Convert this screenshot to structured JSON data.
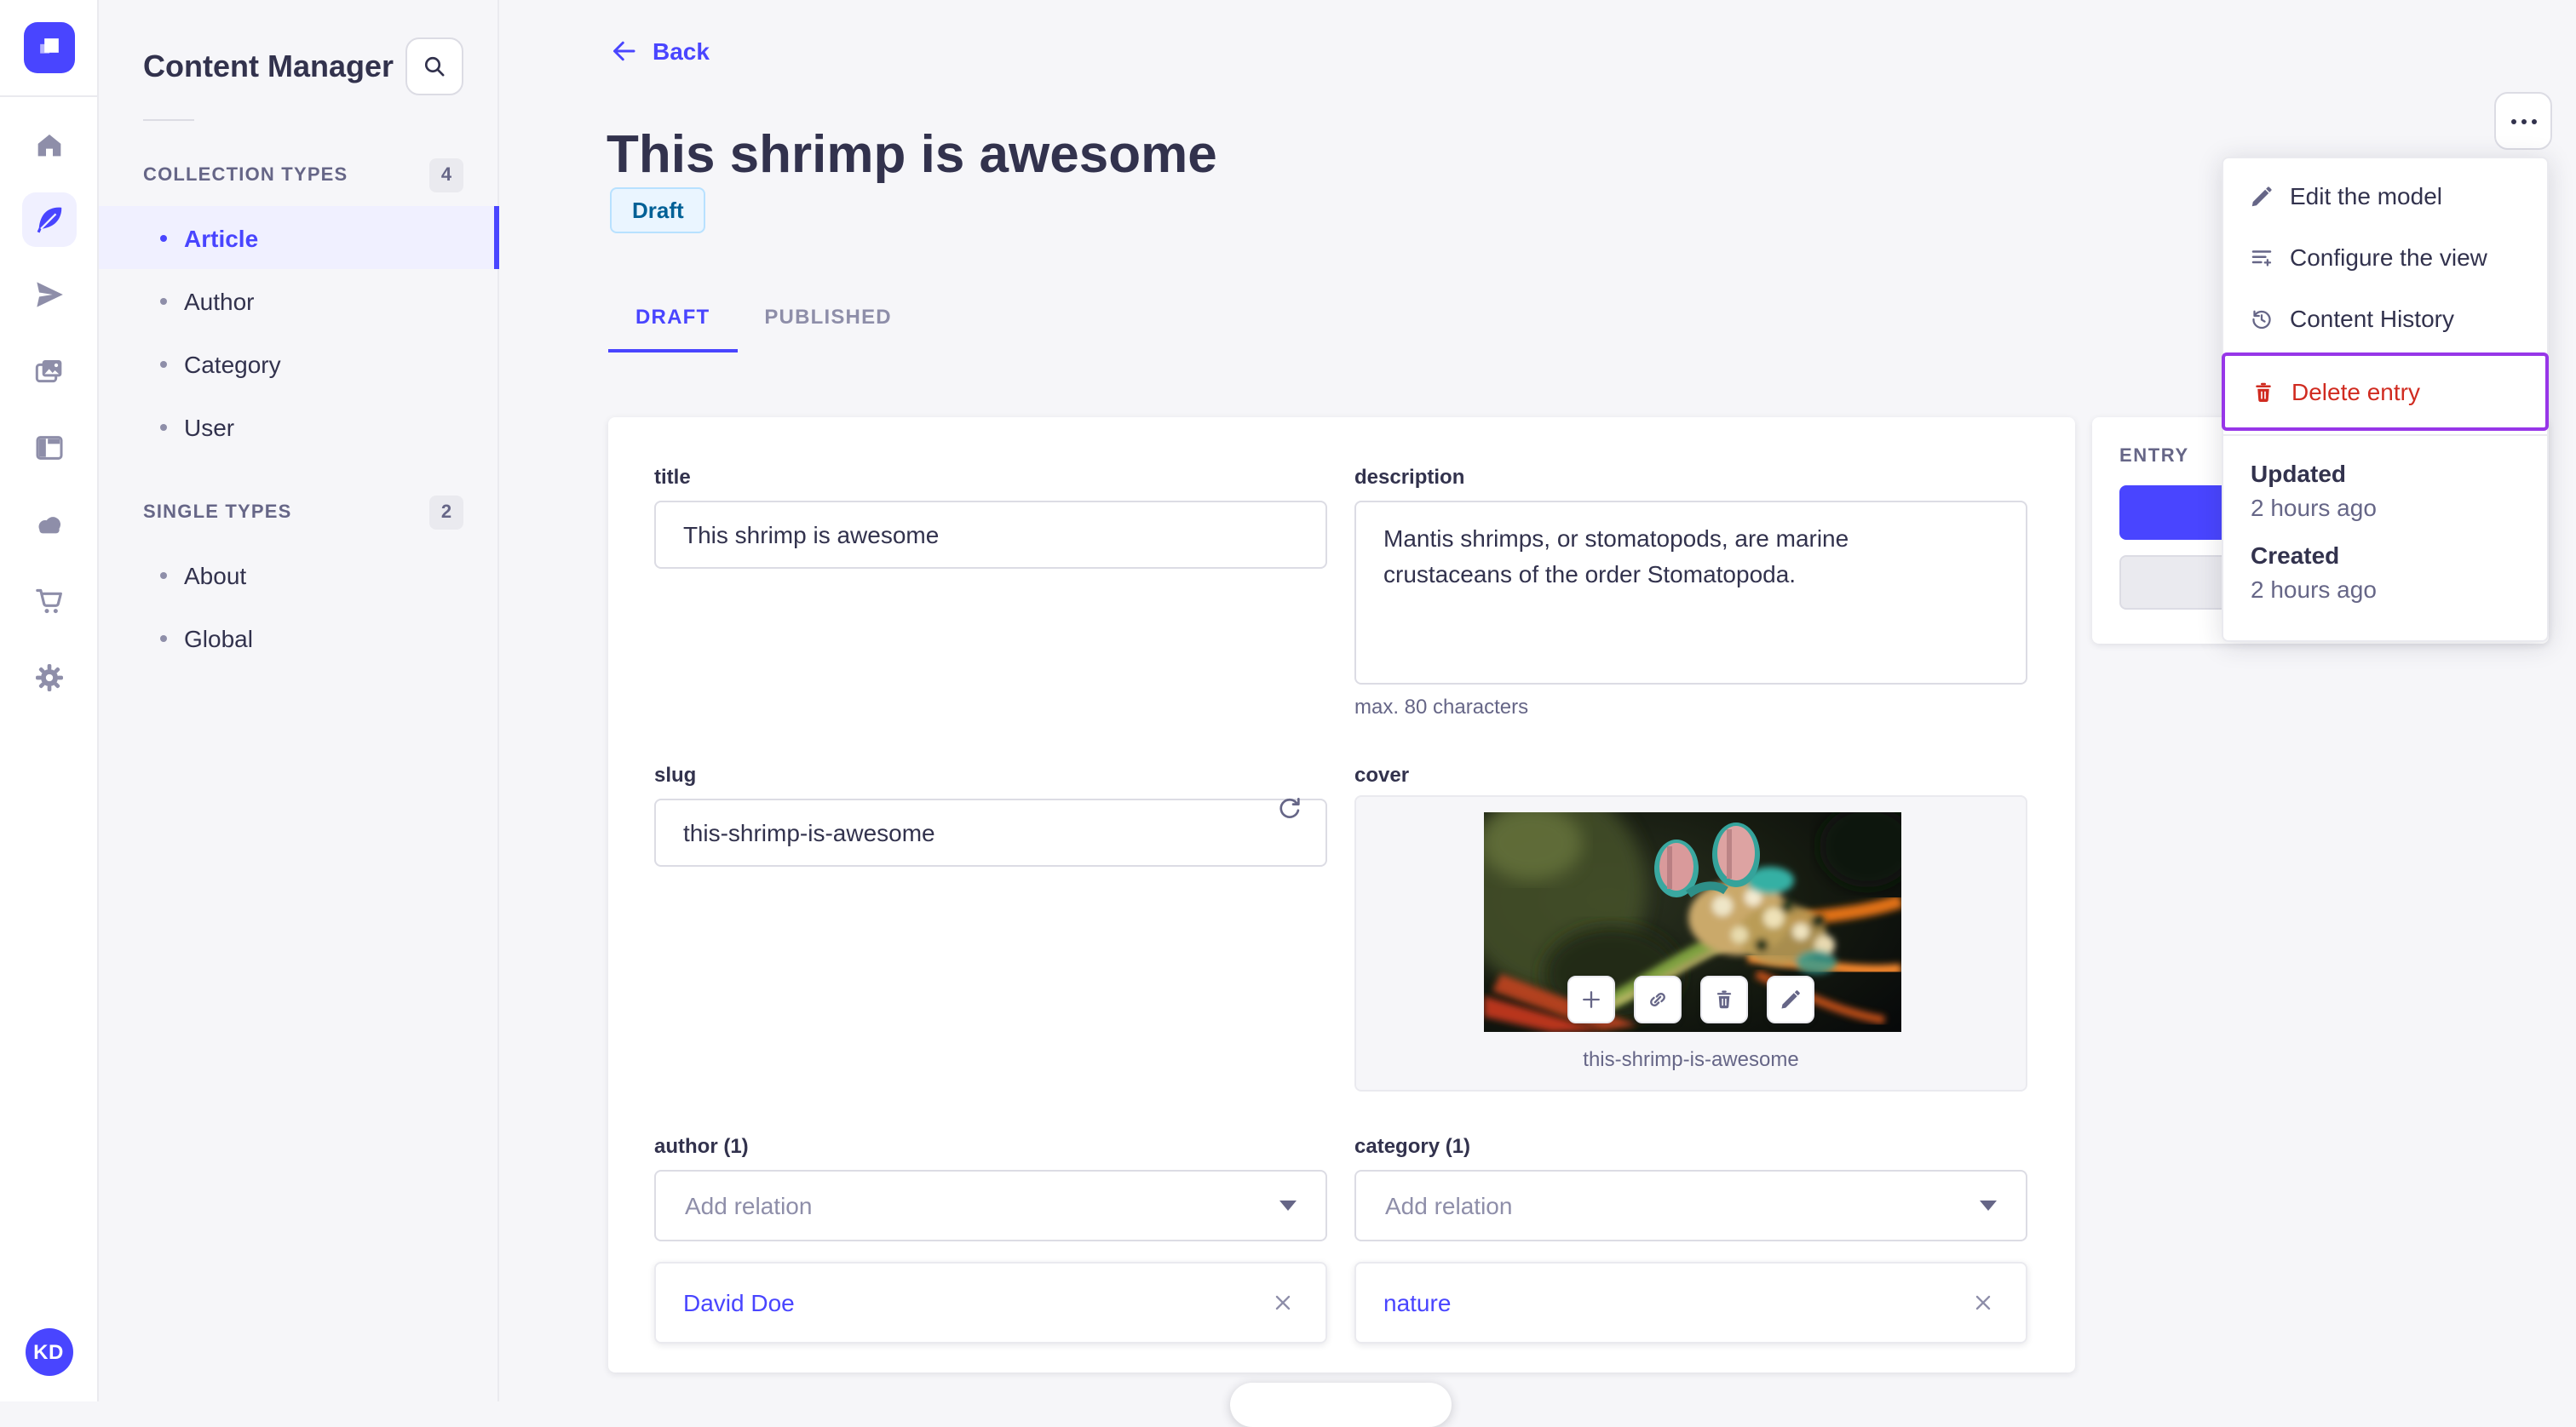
{
  "colors": {
    "primary": "#4945ff",
    "primary_light": "#f0f0ff",
    "danger": "#d02b20",
    "highlight_border": "#9736e8",
    "text": "#32324d",
    "text_muted": "#666687",
    "draft_bg": "#eaf5ff",
    "draft_border": "#b8e1ff",
    "draft_text": "#006096",
    "background": "#f6f6f9"
  },
  "iconbar": {
    "logo_icon": "strapi-logo",
    "items": [
      {
        "icon": "home-icon",
        "active": false
      },
      {
        "icon": "feather-icon",
        "active": true
      },
      {
        "icon": "paper-plane-icon",
        "active": false
      },
      {
        "icon": "media-images-icon",
        "active": false
      },
      {
        "icon": "layout-icon",
        "active": false
      },
      {
        "icon": "cloud-icon",
        "active": false
      },
      {
        "icon": "cart-icon",
        "active": false
      },
      {
        "icon": "gear-icon",
        "active": false
      }
    ],
    "avatar_initials": "KD"
  },
  "sidebar": {
    "title": "Content Manager",
    "search_icon": "search-icon",
    "sections": [
      {
        "label": "COLLECTION TYPES",
        "count": "4",
        "items": [
          {
            "label": "Article",
            "active": true
          },
          {
            "label": "Author",
            "active": false
          },
          {
            "label": "Category",
            "active": false
          },
          {
            "label": "User",
            "active": false
          }
        ]
      },
      {
        "label": "SINGLE TYPES",
        "count": "2",
        "items": [
          {
            "label": "About",
            "active": false
          },
          {
            "label": "Global",
            "active": false
          }
        ]
      }
    ]
  },
  "header": {
    "back_label": "Back",
    "title": "This shrimp is awesome",
    "status": "Draft",
    "tabs": [
      {
        "label": "DRAFT",
        "active": true
      },
      {
        "label": "PUBLISHED",
        "active": false
      }
    ],
    "more_icon": "ellipsis-icon"
  },
  "form": {
    "title": {
      "label": "title",
      "value": "This shrimp is awesome"
    },
    "description": {
      "label": "description",
      "value": "Mantis shrimps, or stomatopods, are marine crustaceans of the order Stomatopoda.",
      "helper": "max. 80 characters"
    },
    "slug": {
      "label": "slug",
      "value": "this-shrimp-is-awesome",
      "action_icon": "refresh-icon"
    },
    "cover": {
      "label": "cover",
      "caption": "this-shrimp-is-awesome",
      "action_icons": [
        "plus-icon",
        "link-icon",
        "trash-icon",
        "pencil-icon"
      ]
    },
    "author": {
      "label": "author (1)",
      "placeholder": "Add relation",
      "relation": "David Doe"
    },
    "category": {
      "label": "category (1)",
      "placeholder": "Add relation",
      "relation": "nature"
    }
  },
  "entry_panel": {
    "title": "ENTRY"
  },
  "menu": {
    "items": [
      {
        "icon": "pencil-icon",
        "label": "Edit the model"
      },
      {
        "icon": "list-plus-icon",
        "label": "Configure the view"
      },
      {
        "icon": "history-icon",
        "label": "Content History"
      },
      {
        "icon": "trash-icon",
        "label": "Delete entry",
        "danger": true,
        "highlighted": true
      }
    ],
    "meta": [
      {
        "label": "Updated",
        "value": "2 hours ago"
      },
      {
        "label": "Created",
        "value": "2 hours ago"
      }
    ]
  }
}
